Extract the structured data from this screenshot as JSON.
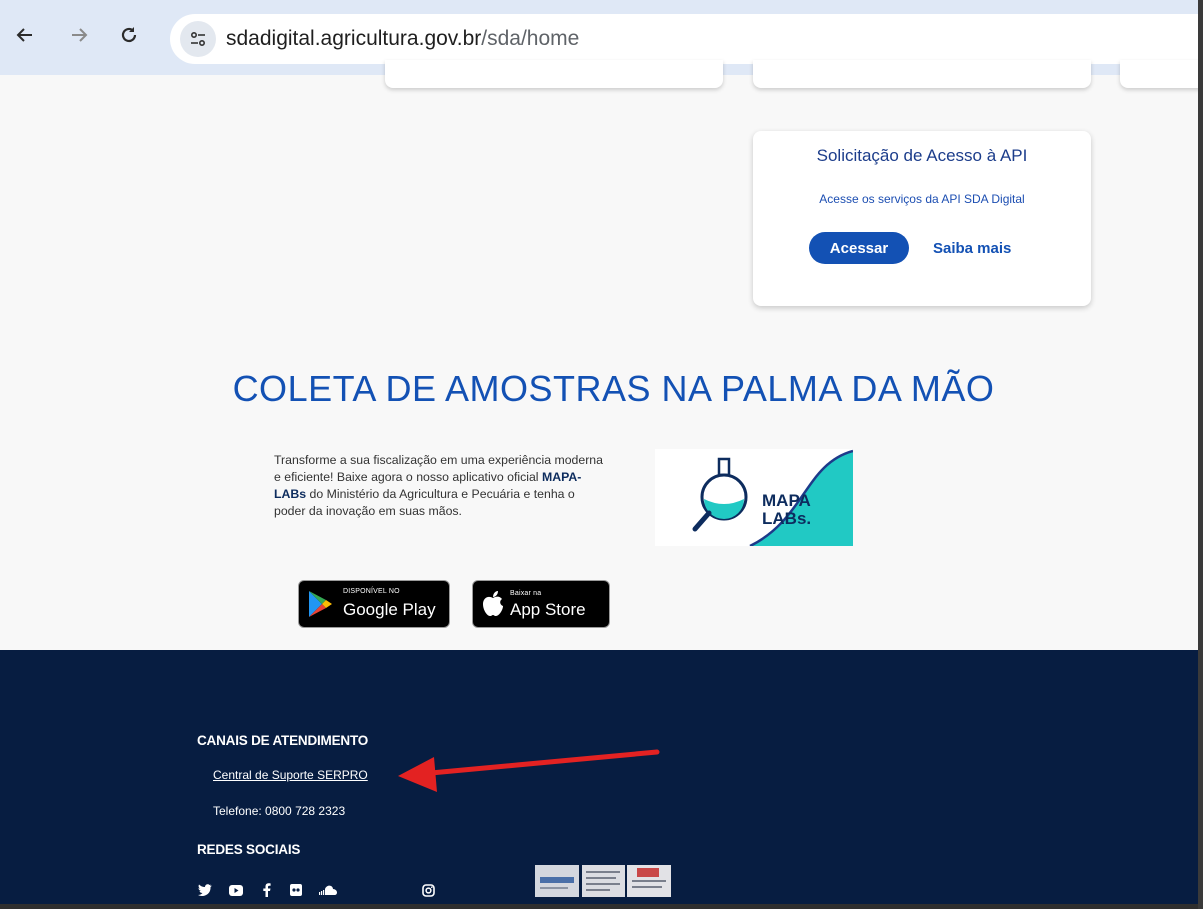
{
  "browser": {
    "url_host": "sdadigital.agricultura.gov.br",
    "url_path": "/sda/home"
  },
  "api_card": {
    "title": "Solicitação de Acesso à API",
    "description": "Acesse os serviços da API SDA Digital",
    "primary_button": "Acessar",
    "secondary_link": "Saiba mais"
  },
  "promo": {
    "title": "COLETA DE AMOSTRAS NA PALMA DA MÃO",
    "text_before": "Transforme a sua fiscalização em uma experiência moderna e eficiente! Baixe agora o nosso aplicativo oficial ",
    "text_bold": "MAPA-LABs",
    "text_after": " do Ministério da Agricultura e Pecuária e tenha o poder da inovação em suas mãos.",
    "logo_line1": "MAPA",
    "logo_line2": "LABs.",
    "google_small": "DISPONÍVEL NO",
    "google_big": "Google Play",
    "apple_small": "Baixar na",
    "apple_big": "App Store"
  },
  "footer": {
    "canais_heading": "CANAIS DE ATENDIMENTO",
    "support_link": "Central de Suporte SERPRO",
    "phone": "Telefone: 0800 728 2323",
    "redes_heading": "REDES SOCIAIS"
  },
  "colors": {
    "brand_blue": "#1351b4",
    "footer_bg": "#071d41",
    "annotation_arrow": "#e32222"
  },
  "icons": [
    "back-arrow-icon",
    "forward-arrow-icon",
    "reload-icon",
    "site-settings-icon",
    "google-play-icon",
    "apple-icon",
    "twitter-icon",
    "youtube-icon",
    "facebook-icon",
    "flickr-icon",
    "soundcloud-icon",
    "instagram-icon"
  ]
}
